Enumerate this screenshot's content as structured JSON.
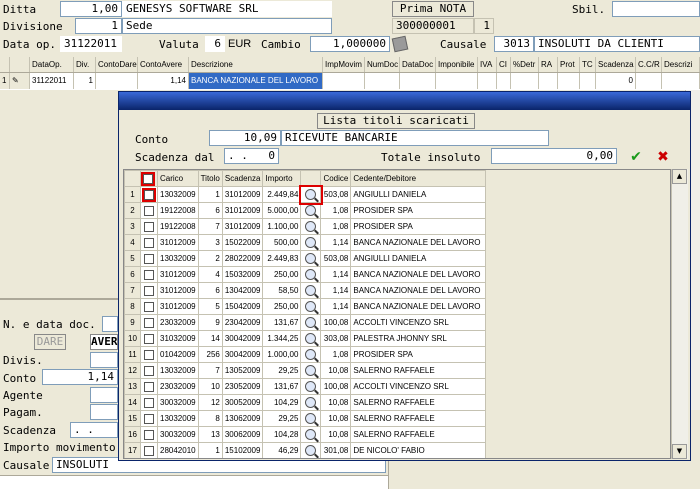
{
  "header": {
    "ditta_label": "Ditta",
    "ditta_value": "1,00",
    "ditta_name": "GENESYS SOFTWARE SRL",
    "prima_nota": "Prima NOTA",
    "sbil_label": "Sbil.",
    "divisione_label": "Divisione",
    "divisione_value": "1",
    "divisione_name": "Sede",
    "reg_number": "300000001",
    "reg_sub": "1",
    "data_op_label": "Data op.",
    "data_op_value": "31122011",
    "valuta_label": "Valuta",
    "valuta_value": "6",
    "valuta_code": "EUR",
    "cambio_label": "Cambio",
    "cambio_value": "1,000000",
    "causale_label": "Causale",
    "causale_code": "3013",
    "causale_desc": "INSOLUTI DA CLIENTI"
  },
  "top_grid": {
    "columns": [
      "",
      "DataOp.",
      "Div.",
      "ContoDare",
      "ContoAvere",
      "Descrizione",
      "ImpMovim",
      "NumDoc",
      "DataDoc",
      "Imponibile",
      "IVA",
      "CI",
      "%Detr",
      "RA",
      "Prot",
      "TC",
      "Scadenza",
      "C.C/R",
      "Descrizi"
    ],
    "row": {
      "num": "1",
      "dataop": "31122011",
      "div": "1",
      "contodare": "",
      "contoavere": "1,14",
      "descrizione": "BANCA NAZIONALE DEL LAVORO",
      "tc": "0"
    }
  },
  "left_panel": {
    "ndata_label": "N. e data doc.",
    "dare_label": "DARE",
    "avere_label": "AVER",
    "divis_label": "Divis.",
    "conto_label": "Conto",
    "conto_value": "1,14",
    "agente_label": "Agente",
    "pagam_label": "Pagam.",
    "scadenza_label": "Scadenza",
    "scadenza_value": ". .",
    "importo_label": "Importo movimento",
    "causale_label": "Causale",
    "causale_value": "INSOLUTI"
  },
  "dialog": {
    "title": "Lista titoli scaricati",
    "conto_label": "Conto",
    "conto_value": "10,09",
    "conto_desc": "RICEVUTE BANCARIE",
    "scadenza_dal_label": "Scadenza dal",
    "scadenza_dal_value": ". .",
    "scadenza_dal_num": "0",
    "totale_label": "Totale insoluto",
    "totale_value": "0,00",
    "columns": {
      "carico": "Carico",
      "titolo": "Titolo",
      "scadenza": "Scadenza",
      "importo": "Importo",
      "codice": "Codice",
      "cedente": "Cedente/Debitore"
    },
    "rows": [
      {
        "n": "1",
        "carico": "13032009",
        "titolo": "1",
        "scadenza": "31012009",
        "importo": "2.449,84",
        "codice": "503,08",
        "cedente": "ANGIULLI DANIELA"
      },
      {
        "n": "2",
        "carico": "19122008",
        "titolo": "6",
        "scadenza": "31012009",
        "importo": "5.000,00",
        "codice": "1,08",
        "cedente": "PROSIDER SPA"
      },
      {
        "n": "3",
        "carico": "19122008",
        "titolo": "7",
        "scadenza": "31012009",
        "importo": "1.100,00",
        "codice": "1,08",
        "cedente": "PROSIDER SPA"
      },
      {
        "n": "4",
        "carico": "31012009",
        "titolo": "3",
        "scadenza": "15022009",
        "importo": "500,00",
        "codice": "1,14",
        "cedente": "BANCA NAZIONALE DEL LAVORO"
      },
      {
        "n": "5",
        "carico": "13032009",
        "titolo": "2",
        "scadenza": "28022009",
        "importo": "2.449,83",
        "codice": "503,08",
        "cedente": "ANGIULLI DANIELA"
      },
      {
        "n": "6",
        "carico": "31012009",
        "titolo": "4",
        "scadenza": "15032009",
        "importo": "250,00",
        "codice": "1,14",
        "cedente": "BANCA NAZIONALE DEL LAVORO"
      },
      {
        "n": "7",
        "carico": "31012009",
        "titolo": "6",
        "scadenza": "13042009",
        "importo": "58,50",
        "codice": "1,14",
        "cedente": "BANCA NAZIONALE DEL LAVORO"
      },
      {
        "n": "8",
        "carico": "31012009",
        "titolo": "5",
        "scadenza": "15042009",
        "importo": "250,00",
        "codice": "1,14",
        "cedente": "BANCA NAZIONALE DEL LAVORO"
      },
      {
        "n": "9",
        "carico": "23032009",
        "titolo": "9",
        "scadenza": "23042009",
        "importo": "131,67",
        "codice": "100,08",
        "cedente": "ACCOLTI VINCENZO SRL"
      },
      {
        "n": "10",
        "carico": "31032009",
        "titolo": "14",
        "scadenza": "30042009",
        "importo": "1.344,25",
        "codice": "303,08",
        "cedente": "PALESTRA JHONNY SRL"
      },
      {
        "n": "11",
        "carico": "01042009",
        "titolo": "256",
        "scadenza": "30042009",
        "importo": "1.000,00",
        "codice": "1,08",
        "cedente": "PROSIDER SPA"
      },
      {
        "n": "12",
        "carico": "13032009",
        "titolo": "7",
        "scadenza": "13052009",
        "importo": "29,25",
        "codice": "10,08",
        "cedente": "SALERNO RAFFAELE"
      },
      {
        "n": "13",
        "carico": "23032009",
        "titolo": "10",
        "scadenza": "23052009",
        "importo": "131,67",
        "codice": "100,08",
        "cedente": "ACCOLTI VINCENZO SRL"
      },
      {
        "n": "14",
        "carico": "30032009",
        "titolo": "12",
        "scadenza": "30052009",
        "importo": "104,29",
        "codice": "10,08",
        "cedente": "SALERNO RAFFAELE"
      },
      {
        "n": "15",
        "carico": "13032009",
        "titolo": "8",
        "scadenza": "13062009",
        "importo": "29,25",
        "codice": "10,08",
        "cedente": "SALERNO RAFFAELE"
      },
      {
        "n": "16",
        "carico": "30032009",
        "titolo": "13",
        "scadenza": "30062009",
        "importo": "104,28",
        "codice": "10,08",
        "cedente": "SALERNO RAFFAELE"
      },
      {
        "n": "17",
        "carico": "28042010",
        "titolo": "1",
        "scadenza": "15102009",
        "importo": "46,29",
        "codice": "301,08",
        "cedente": "DE NICOLO' FABIO"
      }
    ]
  }
}
